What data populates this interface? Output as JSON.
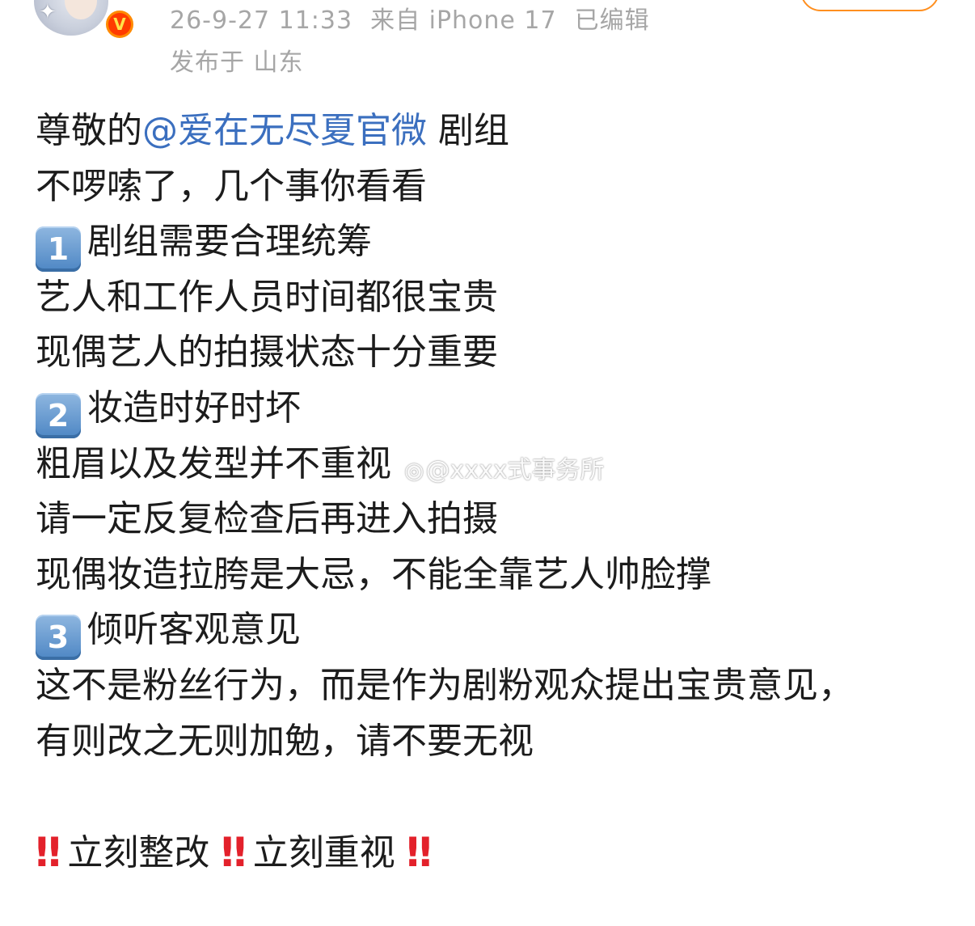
{
  "header": {
    "avatar_icon": "user-avatar",
    "verified_badge": "V",
    "timestamp": "26-9-27 11:33",
    "source": "来自 iPhone 17",
    "edited": "已编辑",
    "location": "发布于 山东"
  },
  "post": {
    "line1_prefix": "尊敬的",
    "line1_mention": "@爱在无尽夏官微",
    "line1_suffix": " 剧组",
    "line2": "不啰嗦了，几个事你看看",
    "point1_num": "1",
    "point1_text": "剧组需要合理统筹",
    "line4": "艺人和工作人员时间都很宝贵",
    "line5": "现偶艺人的拍摄状态十分重要",
    "point2_num": "2",
    "point2_text": "妆造时好时坏",
    "line7": "粗眉以及发型并不重视",
    "line8": "请一定反复检查后再进入拍摄",
    "line9": "现偶妆造拉胯是大忌，不能全靠艺人帅脸撑",
    "point3_num": "3",
    "point3_text": "倾听客观意见",
    "line11": "这不是粉丝行为，而是作为剧粉观众提出宝贵意见，",
    "line12": "有则改之无则加勉，请不要无视",
    "bang": "‼",
    "final_1": "立刻整改",
    "final_2": "立刻重视"
  },
  "watermark": {
    "text": "@xxxx式事务所",
    "logo_icon": "weibo-logo"
  }
}
